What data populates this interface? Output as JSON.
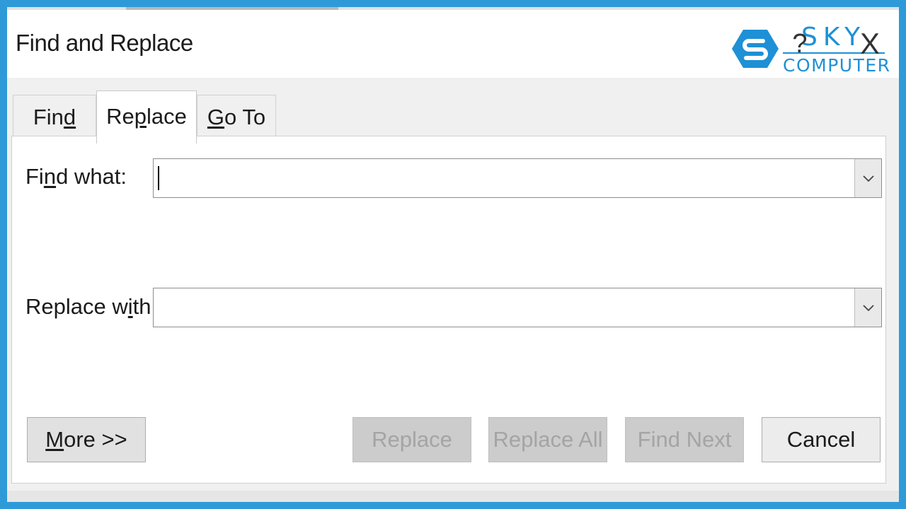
{
  "window": {
    "title": "Find and Replace",
    "help_label": "?",
    "close_label": "X"
  },
  "logo": {
    "line1": "SKY",
    "line2": "COMPUTER",
    "color": "#1e90d6"
  },
  "tabs": [
    {
      "pre": "Fin",
      "accel": "d",
      "post": "",
      "selected": false
    },
    {
      "pre": "Re",
      "accel": "p",
      "post": "lace",
      "selected": true
    },
    {
      "pre": "",
      "accel": "G",
      "post": "o To",
      "selected": false
    }
  ],
  "find_what": {
    "label_pre": "Fi",
    "label_accel": "n",
    "label_post": "d what:",
    "value": "",
    "dropdown_icon": "chevron-down-icon"
  },
  "replace_with": {
    "label_pre": "Replace w",
    "label_accel": "i",
    "label_post": "th:",
    "value": "",
    "dropdown_icon": "chevron-down-icon"
  },
  "buttons": {
    "more_accel": "M",
    "more_rest": "ore >>",
    "replace": "Replace",
    "replace_all": "Replace All",
    "find_next": "Find Next",
    "cancel": "Cancel"
  },
  "colors": {
    "frame": "#2e9ad8",
    "disabled_text": "#a4a4a4"
  }
}
